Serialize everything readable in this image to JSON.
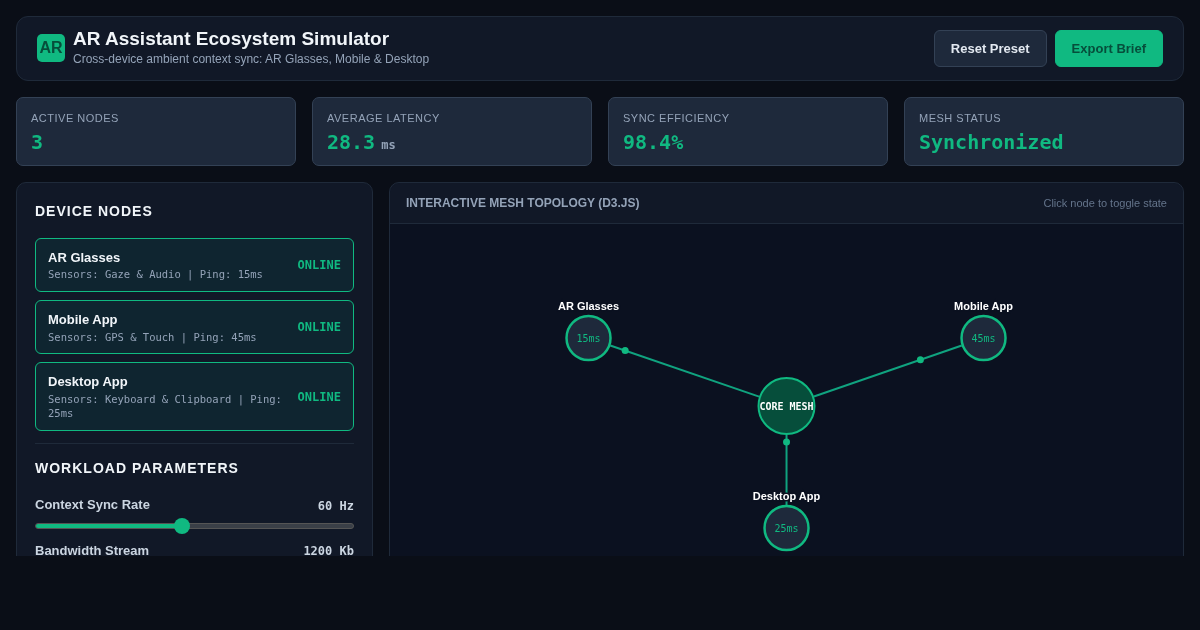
{
  "header": {
    "logo": "AR",
    "title": "AR Assistant Ecosystem Simulator",
    "subtitle": "Cross-device ambient context sync: AR Glasses, Mobile & Desktop",
    "buttons": [
      {
        "label": "Reset Preset",
        "kind": "secondary"
      },
      {
        "label": "Export Brief",
        "kind": "primary"
      }
    ]
  },
  "stats": [
    {
      "label": "ACTIVE NODES",
      "value": "3"
    },
    {
      "label": "AVERAGE LATENCY",
      "value": "28.3",
      "unit": "ms"
    },
    {
      "label": "SYNC EFFICIENCY",
      "value": "98.4%"
    },
    {
      "label": "MESH STATUS",
      "value": "Synchronized"
    }
  ],
  "device_nodes": {
    "title": "DEVICE NODES",
    "items": [
      {
        "name": "AR Glasses",
        "details": "Sensors: Gaze & Audio | Ping: 15ms",
        "status": "ONLINE",
        "online": true
      },
      {
        "name": "Mobile App",
        "details": "Sensors: GPS & Touch | Ping: 45ms",
        "status": "ONLINE",
        "online": true
      },
      {
        "name": "Desktop App",
        "details": "Sensors: Keyboard & Clipboard | Ping: 25ms",
        "status": "ONLINE",
        "online": true
      }
    ]
  },
  "workload": {
    "title": "WORKLOAD PARAMETERS",
    "params": [
      {
        "label": "Context Sync Rate",
        "reading": "60 Hz",
        "level": 0.46
      },
      {
        "label": "Bandwidth Stream",
        "reading": "1200 Kb"
      }
    ]
  },
  "topology": {
    "title": "INTERACTIVE MESH TOPOLOGY (D3.JS)",
    "hint": "Click node to toggle state",
    "nodes": [
      {
        "kind": "core",
        "label": "CORE MESH"
      },
      {
        "kind": "device",
        "label": "AR Glasses",
        "latency": "15ms",
        "online": true
      },
      {
        "kind": "device",
        "label": "Mobile App",
        "latency": "45ms",
        "online": true
      },
      {
        "kind": "device",
        "label": "Desktop App",
        "latency": "25ms",
        "online": true
      }
    ]
  }
}
